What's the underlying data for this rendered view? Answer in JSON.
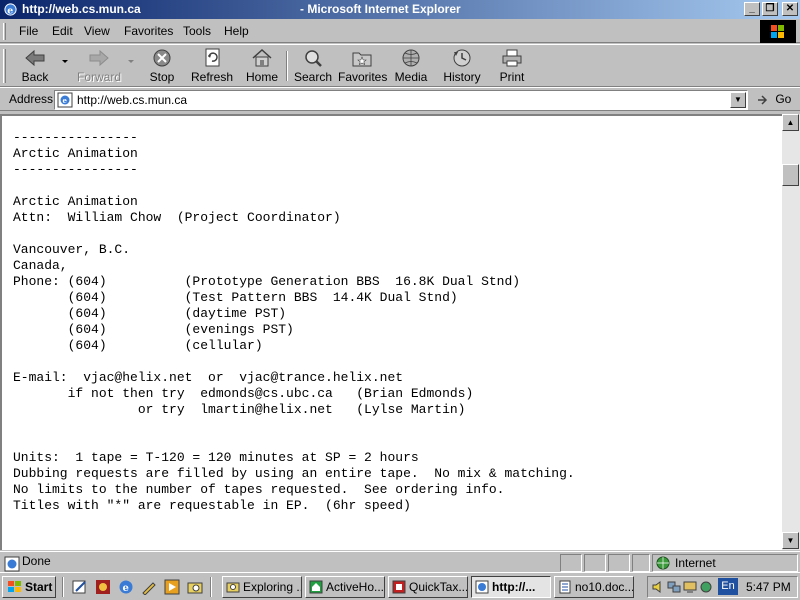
{
  "window": {
    "title_url": "http://web.cs.mun.ca",
    "title_app": " - Microsoft Internet Explorer"
  },
  "menu": [
    "File",
    "Edit",
    "View",
    "Favorites",
    "Tools",
    "Help"
  ],
  "toolbar": {
    "back": "Back",
    "forward": "Forward",
    "stop": "Stop",
    "refresh": "Refresh",
    "home": "Home",
    "search": "Search",
    "favorites": "Favorites",
    "media": "Media",
    "history": "History",
    "print": "Print"
  },
  "address": {
    "label": "Address",
    "url": "http://web.cs.mun.ca",
    "go": "Go"
  },
  "page_text": "----------------\nArctic Animation\n----------------\n\nArctic Animation\nAttn:  William Chow  (Project Coordinator)\n\nVancouver, B.C.\nCanada,\nPhone: (604)          (Prototype Generation BBS  16.8K Dual Stnd)\n       (604)          (Test Pattern BBS  14.4K Dual Stnd)\n       (604)          (daytime PST)\n       (604)          (evenings PST)\n       (604)          (cellular)\n\nE-mail:  vjac@helix.net  or  vjac@trance.helix.net\n       if not then try  edmonds@cs.ubc.ca   (Brian Edmonds)\n                or try  lmartin@helix.net   (Lylse Martin)\n\n\nUnits:  1 tape = T-120 = 120 minutes at SP = 2 hours\nDubbing requests are filled by using an entire tape.  No mix & matching.\nNo limits to the number of tapes requested.  See ordering info.\nTitles with \"*\" are requestable in EP.  (6hr speed)",
  "status": {
    "text": "Done",
    "zone": "Internet"
  },
  "taskbar": {
    "start": "Start",
    "tasks": [
      "Exploring ...",
      "ActiveHo...",
      "QuickTax...",
      "http://...",
      "no10.doc..."
    ],
    "clock": "5:47 PM",
    "lang": "En"
  }
}
